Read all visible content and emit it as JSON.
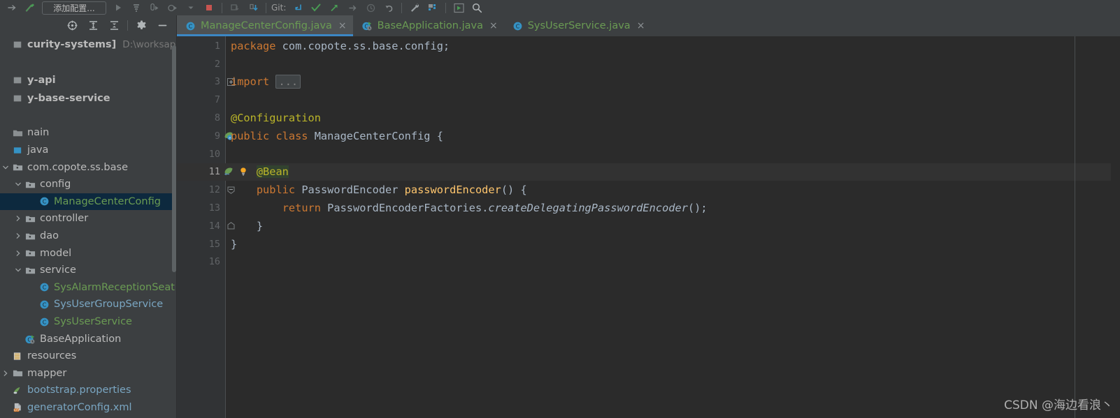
{
  "toolbar": {
    "icons": [
      {
        "name": "forward-arrow-icon"
      },
      {
        "name": "build-hammer-icon"
      }
    ],
    "run_configuration_label": "添加配置...",
    "run_icons": [
      {
        "name": "run-icon"
      },
      {
        "name": "build-project-icon"
      },
      {
        "name": "debug-icon"
      },
      {
        "name": "run-with-coverage-icon"
      },
      {
        "name": "chevron-down-icon"
      },
      {
        "name": "stop-icon"
      }
    ],
    "more_icons": [
      {
        "name": "attach-debugger-icon"
      },
      {
        "name": "download-icon"
      }
    ],
    "git_label": "Git:",
    "git_icons": [
      {
        "name": "update-project-icon"
      },
      {
        "name": "commit-icon"
      },
      {
        "name": "push-icon"
      },
      {
        "name": "arrow-right-icon"
      },
      {
        "name": "history-icon"
      },
      {
        "name": "rollback-icon"
      }
    ],
    "right_icons": [
      {
        "name": "wrench-icon"
      },
      {
        "name": "database-icon"
      },
      {
        "name": "run-anything-icon"
      },
      {
        "name": "search-icon"
      }
    ]
  },
  "project_panel": {
    "toolbar_icons": [
      {
        "name": "select-opened-file-icon"
      },
      {
        "name": "expand-all-icon"
      },
      {
        "name": "collapse-all-icon"
      },
      {
        "name": "gear-icon"
      },
      {
        "name": "hide-panel-icon"
      }
    ],
    "scroll_thumb": "vertical-scrollbar-thumb",
    "tree": [
      {
        "label": "curity-systems]",
        "path": "D:\\worksapce\\anfar",
        "indent": 0,
        "arrow": "",
        "icon": "project-icon",
        "color": "grey",
        "header": true,
        "selected": false
      },
      {
        "label": "",
        "indent": 0,
        "arrow": "",
        "icon": "",
        "color": "grey",
        "header": false,
        "selected": false
      },
      {
        "label": "y-api",
        "indent": 0,
        "arrow": "",
        "icon": "module-icon",
        "color": "grey",
        "header": true,
        "selected": false
      },
      {
        "label": "y-base-service",
        "indent": 0,
        "arrow": "",
        "icon": "module-icon",
        "color": "grey",
        "header": true,
        "selected": false
      },
      {
        "label": "",
        "indent": 0,
        "arrow": "",
        "icon": "",
        "color": "grey",
        "header": false,
        "selected": false
      },
      {
        "label": "nain",
        "indent": 0,
        "arrow": "",
        "icon": "folder-icon",
        "color": "grey",
        "header": false,
        "selected": false
      },
      {
        "label": "java",
        "indent": 0,
        "arrow": "",
        "icon": "source-root-icon",
        "color": "grey",
        "header": false,
        "selected": false
      },
      {
        "label": "com.copote.ss.base",
        "indent": 1,
        "arrow": "expanded",
        "icon": "package-icon",
        "color": "grey",
        "header": false,
        "selected": false
      },
      {
        "label": "config",
        "indent": 2,
        "arrow": "expanded",
        "icon": "package-icon",
        "color": "grey",
        "header": false,
        "selected": false
      },
      {
        "label": "ManageCenterConfig",
        "indent": 3,
        "arrow": "",
        "icon": "java-class-icon",
        "color": "green",
        "header": false,
        "selected": true
      },
      {
        "label": "controller",
        "indent": 2,
        "arrow": "collapsed",
        "icon": "package-icon",
        "color": "grey",
        "header": false,
        "selected": false
      },
      {
        "label": "dao",
        "indent": 2,
        "arrow": "collapsed",
        "icon": "package-icon",
        "color": "grey",
        "header": false,
        "selected": false
      },
      {
        "label": "model",
        "indent": 2,
        "arrow": "collapsed",
        "icon": "package-icon",
        "color": "grey",
        "header": false,
        "selected": false
      },
      {
        "label": "service",
        "indent": 2,
        "arrow": "expanded",
        "icon": "package-icon",
        "color": "grey",
        "header": false,
        "selected": false
      },
      {
        "label": "SysAlarmReceptionSeat",
        "indent": 3,
        "arrow": "",
        "icon": "java-class-icon",
        "color": "green",
        "header": false,
        "selected": false
      },
      {
        "label": "SysUserGroupService",
        "indent": 3,
        "arrow": "",
        "icon": "java-class-icon",
        "color": "blue",
        "header": false,
        "selected": false
      },
      {
        "label": "SysUserService",
        "indent": 3,
        "arrow": "",
        "icon": "java-class-icon",
        "color": "green",
        "header": false,
        "selected": false
      },
      {
        "label": "BaseApplication",
        "indent": 2,
        "arrow": "",
        "icon": "spring-boot-class-icon",
        "color": "grey",
        "header": false,
        "selected": false
      },
      {
        "label": "resources",
        "indent": 0,
        "arrow": "",
        "icon": "resources-root-icon",
        "color": "grey",
        "header": false,
        "selected": false
      },
      {
        "label": "mapper",
        "indent": 1,
        "arrow": "collapsed",
        "icon": "folder-plain-icon",
        "color": "grey",
        "header": false,
        "selected": false
      },
      {
        "label": "bootstrap.properties",
        "indent": 1,
        "arrow": "",
        "icon": "properties-file-icon",
        "color": "blue",
        "header": false,
        "selected": false
      },
      {
        "label": "generatorConfig.xml",
        "indent": 1,
        "arrow": "",
        "icon": "xml-file-icon",
        "color": "blue",
        "header": false,
        "selected": false
      }
    ]
  },
  "tabs": [
    {
      "label": "ManageCenterConfig.java",
      "icon": "java-class-icon",
      "active": true,
      "close": "×"
    },
    {
      "label": "BaseApplication.java",
      "icon": "spring-boot-class-icon",
      "active": false,
      "close": "×"
    },
    {
      "label": "SysUserService.java",
      "icon": "java-class-icon",
      "active": false,
      "close": "×"
    }
  ],
  "editor": {
    "lines": [
      {
        "num": "1",
        "gutter": "",
        "fold": "",
        "bulb": false,
        "current": false,
        "tokens": [
          {
            "t": "package",
            "c": "kw"
          },
          {
            "t": " com.copote.ss.base.config;",
            "c": "txt"
          }
        ]
      },
      {
        "num": "2",
        "gutter": "",
        "fold": "",
        "bulb": false,
        "current": false,
        "tokens": []
      },
      {
        "num": "3",
        "gutter": "",
        "fold": "plus",
        "bulb": false,
        "current": false,
        "tokens": [
          {
            "t": "import",
            "c": "kw"
          },
          {
            "t": " ",
            "c": "txt"
          },
          {
            "t": "...",
            "c": "fold-dots"
          }
        ]
      },
      {
        "num": "7",
        "gutter": "",
        "fold": "",
        "bulb": false,
        "current": false,
        "tokens": []
      },
      {
        "num": "8",
        "gutter": "",
        "fold": "",
        "bulb": false,
        "current": false,
        "tokens": [
          {
            "t": "@Configuration",
            "c": "ann"
          }
        ]
      },
      {
        "num": "9",
        "gutter": "spring-bean-icon",
        "fold": "",
        "bulb": false,
        "current": false,
        "tokens": [
          {
            "t": "public class",
            "c": "kw"
          },
          {
            "t": " ManageCenterConfig {",
            "c": "txt"
          }
        ]
      },
      {
        "num": "10",
        "gutter": "",
        "fold": "",
        "bulb": false,
        "current": false,
        "tokens": []
      },
      {
        "num": "11",
        "gutter": "spring-bean-method-icon",
        "fold": "",
        "bulb": true,
        "current": true,
        "tokens": [
          {
            "t": "    ",
            "c": "txt"
          },
          {
            "t": "@Bean",
            "c": "ann hl-bean"
          }
        ]
      },
      {
        "num": "12",
        "gutter": "",
        "fold": "minus",
        "bulb": false,
        "current": false,
        "tokens": [
          {
            "t": "    ",
            "c": "txt"
          },
          {
            "t": "public",
            "c": "kw"
          },
          {
            "t": " PasswordEncoder ",
            "c": "cls"
          },
          {
            "t": "passwordEncoder",
            "c": "fn"
          },
          {
            "t": "() {",
            "c": "txt"
          }
        ]
      },
      {
        "num": "13",
        "gutter": "",
        "fold": "",
        "bulb": false,
        "current": false,
        "tokens": [
          {
            "t": "        ",
            "c": "txt"
          },
          {
            "t": "return",
            "c": "kw"
          },
          {
            "t": " PasswordEncoderFactories.",
            "c": "cls"
          },
          {
            "t": "createDelegatingPasswordEncoder",
            "c": "cls ital"
          },
          {
            "t": "();",
            "c": "txt"
          }
        ]
      },
      {
        "num": "14",
        "gutter": "",
        "fold": "end",
        "bulb": false,
        "current": false,
        "tokens": [
          {
            "t": "    }",
            "c": "txt"
          }
        ]
      },
      {
        "num": "15",
        "gutter": "",
        "fold": "",
        "bulb": false,
        "current": false,
        "tokens": [
          {
            "t": "}",
            "c": "txt"
          }
        ]
      },
      {
        "num": "16",
        "gutter": "",
        "fold": "",
        "bulb": false,
        "current": false,
        "tokens": []
      }
    ]
  },
  "watermark": "CSDN @海边看浪丶",
  "colors": {
    "background": "#3c3f41",
    "editor_background": "#2b2b2b",
    "gutter_background": "#313335",
    "tab_active": "#4e5254",
    "tab_underline": "#3c87c4",
    "selection": "#0d293e",
    "keyword": "#cc7832",
    "annotation": "#bbb529",
    "text": "#a9b7c6",
    "function": "#ffc66d",
    "green_file": "#6a9b53",
    "blue_file": "#7aa6c2"
  }
}
